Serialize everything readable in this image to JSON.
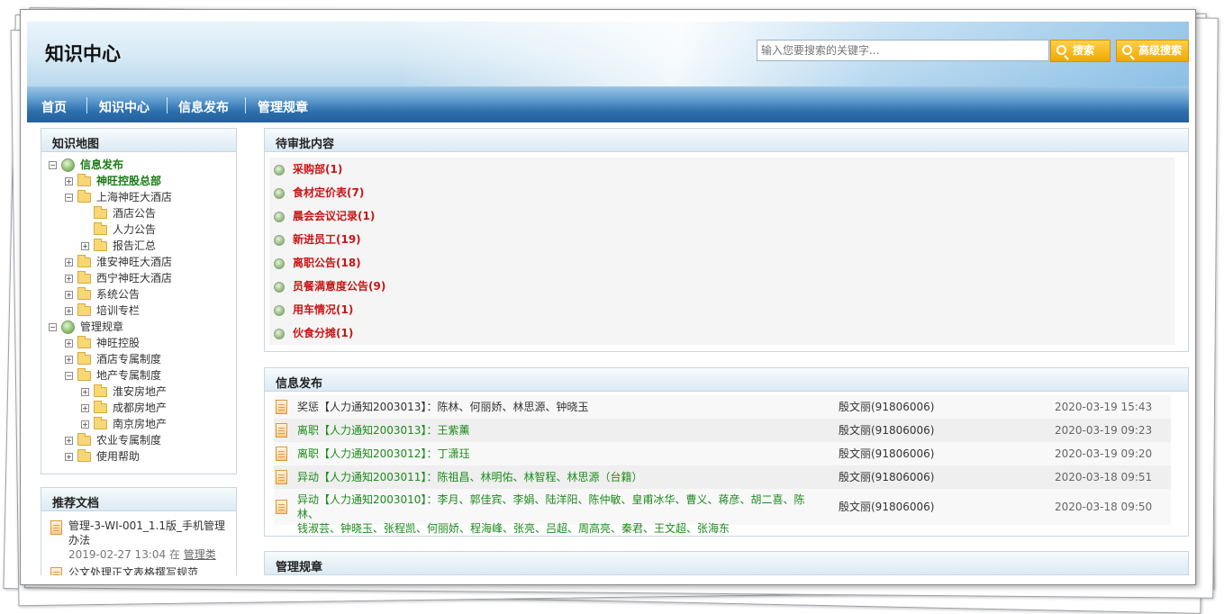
{
  "header": {
    "logo": "知识中心",
    "search_placeholder": "输入您要搜索的关键字...",
    "search_button": "搜索",
    "advanced_search_button": "高级搜索"
  },
  "nav": [
    "首页",
    "知识中心",
    "信息发布",
    "管理规章"
  ],
  "knowledge_map": {
    "title": "知识地图",
    "tree": [
      {
        "label": "信息发布",
        "toggle": "−",
        "icon": "globe",
        "style": "green"
      },
      {
        "label": "神旺控股总部",
        "toggle": "+",
        "icon": "folder",
        "style": "green"
      },
      {
        "label": "上海神旺大酒店",
        "toggle": "−",
        "icon": "folder",
        "style": "normal"
      },
      {
        "label": "酒店公告",
        "toggle": "",
        "icon": "folder",
        "style": "normal"
      },
      {
        "label": "人力公告",
        "toggle": "",
        "icon": "folder",
        "style": "normal"
      },
      {
        "label": "报告汇总",
        "toggle": "+",
        "icon": "folder",
        "style": "normal"
      },
      {
        "label": "淮安神旺大酒店",
        "toggle": "+",
        "icon": "folder",
        "style": "normal"
      },
      {
        "label": "西宁神旺大酒店",
        "toggle": "+",
        "icon": "folder",
        "style": "normal"
      },
      {
        "label": "系统公告",
        "toggle": "+",
        "icon": "folder",
        "style": "normal"
      },
      {
        "label": "培训专栏",
        "toggle": "+",
        "icon": "folder",
        "style": "normal"
      },
      {
        "label": "管理规章",
        "toggle": "−",
        "icon": "globe",
        "style": "normal"
      },
      {
        "label": "神旺控股",
        "toggle": "+",
        "icon": "folder",
        "style": "normal"
      },
      {
        "label": "酒店专属制度",
        "toggle": "+",
        "icon": "folder",
        "style": "normal"
      },
      {
        "label": "地产专属制度",
        "toggle": "−",
        "icon": "folder",
        "style": "normal"
      },
      {
        "label": "淮安房地产",
        "toggle": "+",
        "icon": "folder",
        "style": "normal"
      },
      {
        "label": "成都房地产",
        "toggle": "+",
        "icon": "folder",
        "style": "normal"
      },
      {
        "label": "南京房地产",
        "toggle": "+",
        "icon": "folder",
        "style": "normal"
      },
      {
        "label": "农业专属制度",
        "toggle": "+",
        "icon": "folder",
        "style": "normal"
      },
      {
        "label": "使用帮助",
        "toggle": "+",
        "icon": "folder",
        "style": "normal"
      }
    ]
  },
  "recommended": {
    "title": "推荐文档",
    "items": [
      {
        "title_line1": "管理-3-WI-001_1.1版_手机管理",
        "title_line2": "办法",
        "meta_prefix": "2019-02-27 13:04 在",
        "category": "管理类"
      },
      {
        "title_line1": "公文处理正文表格撰写规范",
        "title_line2": "",
        "meta_prefix": "",
        "category": ""
      }
    ]
  },
  "pending": {
    "title": "待审批内容",
    "items": [
      "采购部(1)",
      "食材定价表(7)",
      "晨会会议记录(1)",
      "新进员工(19)",
      "离职公告(18)",
      "员餐满意度公告(9)",
      "用车情况(1)",
      "伙食分摊(1)"
    ]
  },
  "info": {
    "title": "信息发布",
    "rows": [
      {
        "line1": "奖惩【人力通知2003013】：陈林、何丽娇、林思源、钟晓玉",
        "line2": "",
        "author": "殷文丽(91806006)",
        "time": "2020-03-19 15:43",
        "style": "normal"
      },
      {
        "line1": "离职【人力通知2003013】：王紫薰",
        "line2": "",
        "author": "殷文丽(91806006)",
        "time": "2020-03-19 09:23",
        "style": "green"
      },
      {
        "line1": "离职【人力通知2003012】：丁潇珏",
        "line2": "",
        "author": "殷文丽(91806006)",
        "time": "2020-03-19 09:20",
        "style": "green"
      },
      {
        "line1": "异动【人力通知2003011】：陈祖昌、林明佑、林智程、林思源（台籍）",
        "line2": "",
        "author": "殷文丽(91806006)",
        "time": "2020-03-18 09:51",
        "style": "green"
      },
      {
        "line1": "异动【人力通知2003010】：李月、郭佳宾、李娟、陆洋阳、陈仲敏、皇甫冰华、曹义、蒋彦、胡二喜、陈林、",
        "line2": "钱淑芸、钟晓玉、张程凯、何丽娇、程海峰、张亮、吕超、周高亮、秦君、王文超、张海东",
        "author": "殷文丽(91806006)",
        "time": "2020-03-18 09:50",
        "style": "green"
      }
    ]
  },
  "rules": {
    "title": "管理规章"
  }
}
